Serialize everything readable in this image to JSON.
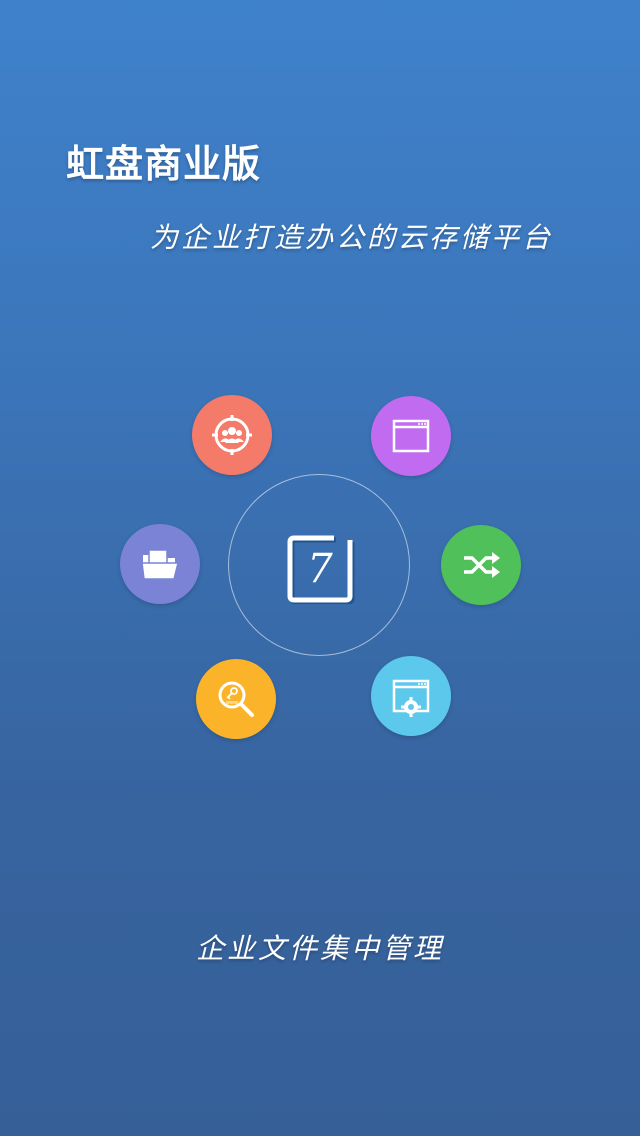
{
  "header": {
    "title": "虹盘商业版",
    "subtitle": "为企业打造办公的云存储平台"
  },
  "center": {
    "logo_text": "7"
  },
  "features": [
    {
      "id": "users",
      "icon": "team-users-icon",
      "color": "#f47a6a"
    },
    {
      "id": "window",
      "icon": "browser-window-icon",
      "color": "#c16cf0"
    },
    {
      "id": "folder",
      "icon": "folder-icon",
      "color": "#7a83d6"
    },
    {
      "id": "shuffle",
      "icon": "shuffle-sync-icon",
      "color": "#4fc05a"
    },
    {
      "id": "search",
      "icon": "search-key-icon",
      "color": "#fbb42a"
    },
    {
      "id": "settings",
      "icon": "browser-settings-icon",
      "color": "#5cc9ec"
    }
  ],
  "footer": {
    "caption": "企业文件集中管理"
  }
}
